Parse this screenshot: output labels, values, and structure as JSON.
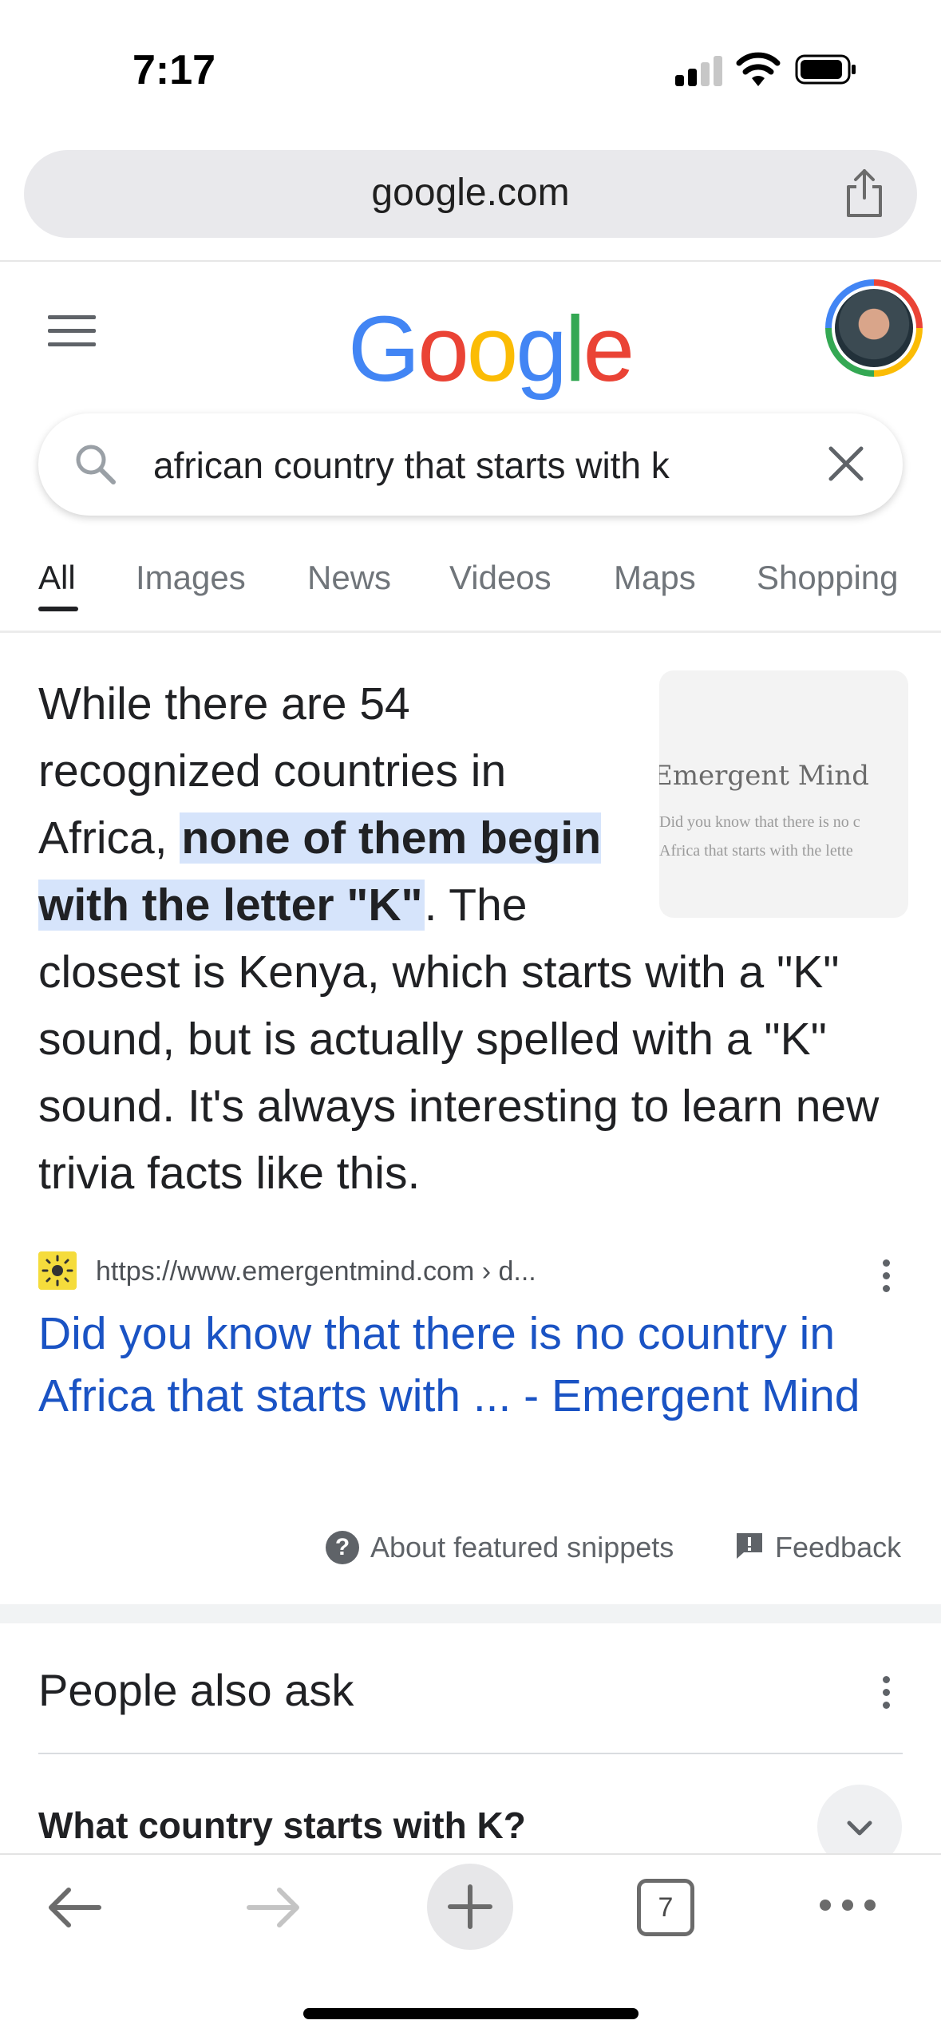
{
  "status_bar": {
    "time": "7:17"
  },
  "browser": {
    "url": "google.com"
  },
  "search": {
    "query": "african country that starts with k"
  },
  "tabs": [
    {
      "label": "All",
      "active": true
    },
    {
      "label": "Images"
    },
    {
      "label": "News"
    },
    {
      "label": "Videos"
    },
    {
      "label": "Maps"
    },
    {
      "label": "Shopping"
    }
  ],
  "snippet": {
    "text_before": "While there are 54 recognized countries in Africa, ",
    "highlight": "none of them begin with the letter \"K\"",
    "text_after": ". The closest is Kenya, which starts with a \"K\" sound, but is actually spelled with a \"K\" sound. It's always interesting to learn new trivia facts like this.",
    "thumbnail": {
      "title": "Emergent Mind",
      "line1": "Did you know that there is no c",
      "line2": "Africa that starts with the lette"
    },
    "source_url": "https://www.emergentmind.com › d...",
    "result_title": "Did you know that there is no country in Africa that starts with ... - Emergent Mind",
    "about_label": "About featured snippets",
    "feedback_label": "Feedback"
  },
  "people_also_ask": {
    "title": "People also ask",
    "questions": [
      "What country starts with K?"
    ]
  },
  "toolbar": {
    "tab_count": "7"
  },
  "colors": {
    "link": "#1a53c4",
    "highlight": "#d6e4fb",
    "favicon": "#f5dc3c"
  }
}
